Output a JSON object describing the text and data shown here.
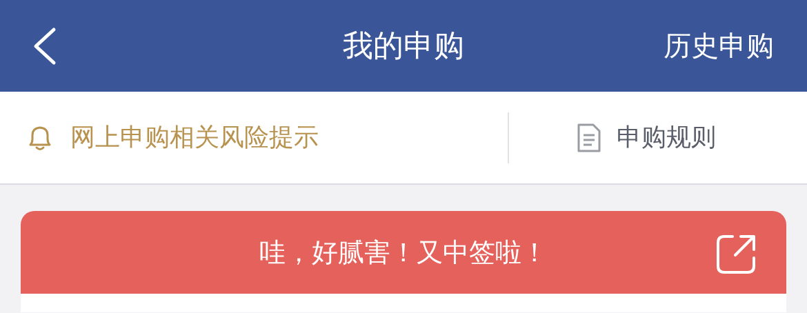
{
  "header": {
    "title": "我的申购",
    "action": "历史申购"
  },
  "notices": [
    {
      "kind": "warning",
      "label": "网上申购相关风险提示"
    },
    {
      "kind": "document",
      "label": "申购规则"
    }
  ],
  "banner": {
    "text": "哇，好腻害！又中签啦！"
  }
}
